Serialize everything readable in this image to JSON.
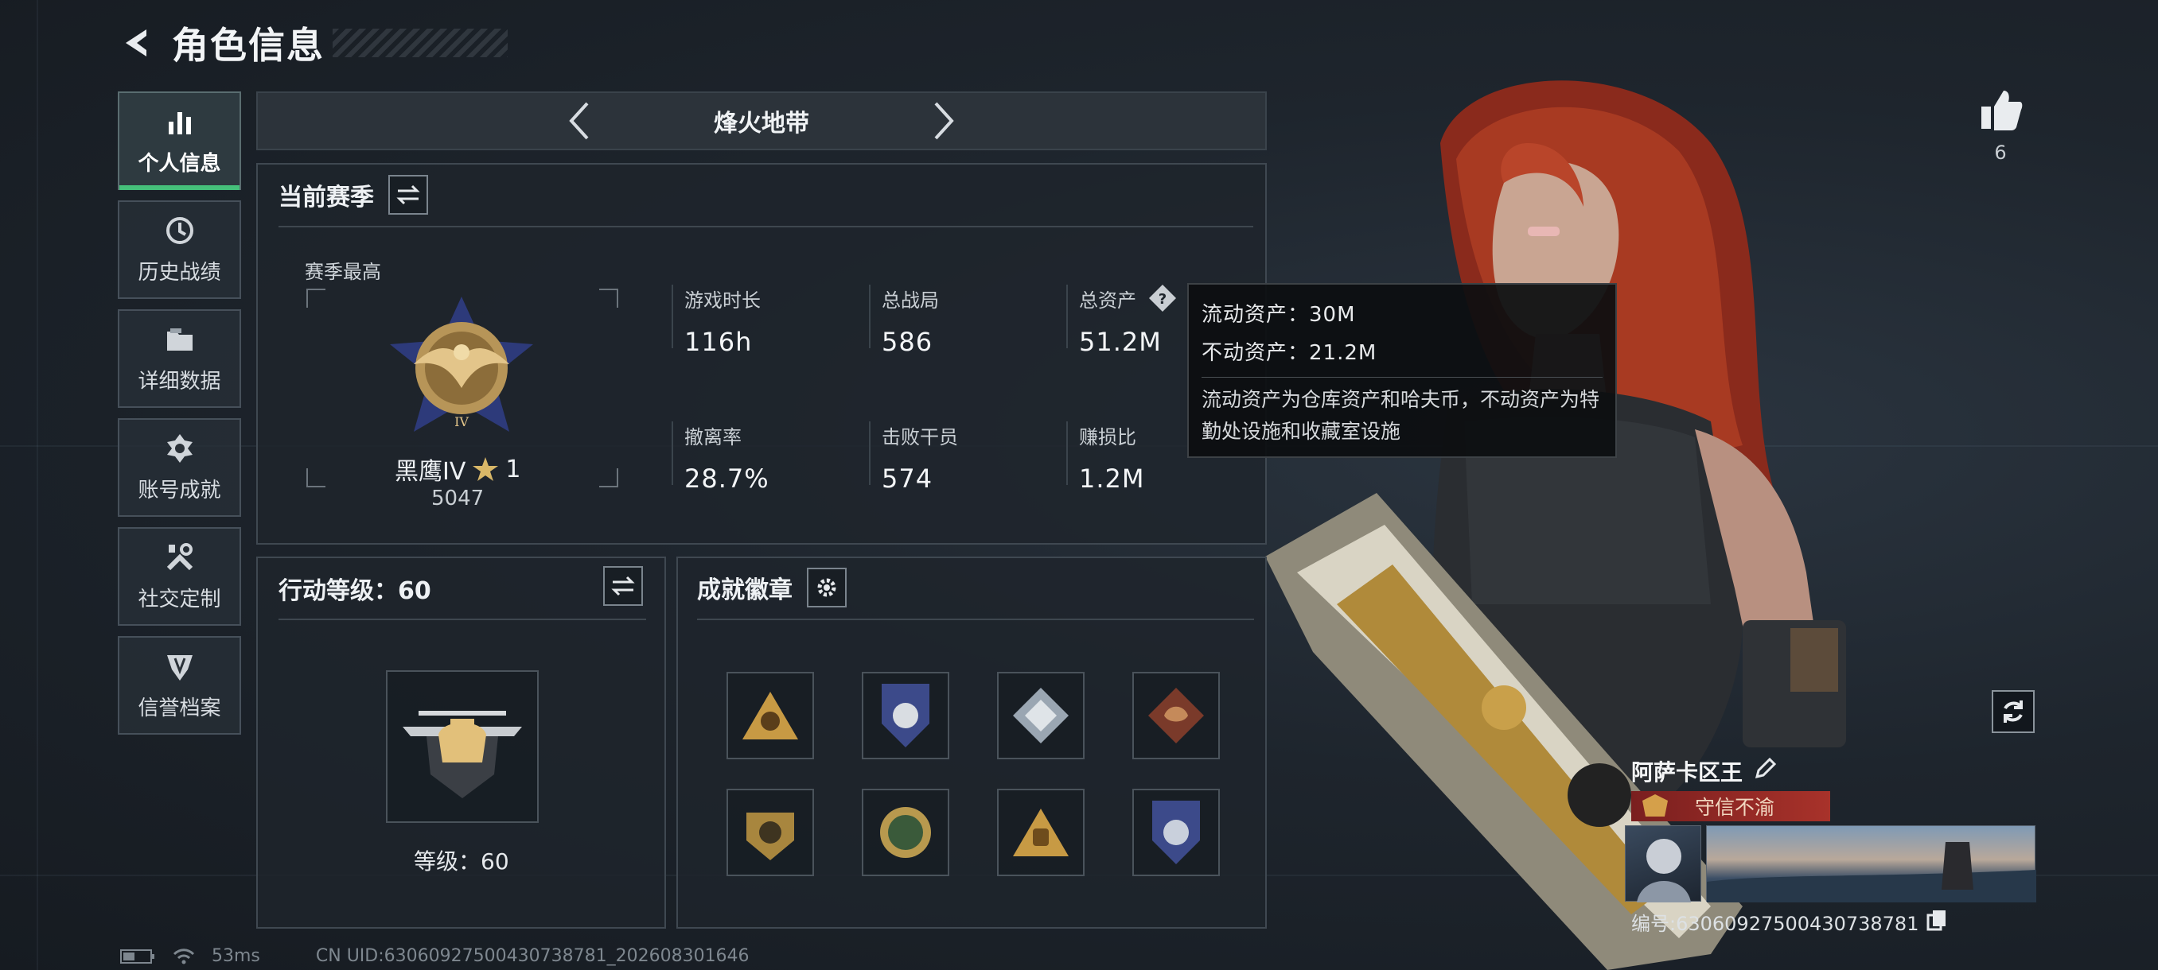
{
  "header": {
    "title": "角色信息"
  },
  "sidebar": {
    "items": [
      {
        "label": "个人信息",
        "icon": "bar-chart-icon",
        "active": true
      },
      {
        "label": "历史战绩",
        "icon": "clock-icon",
        "active": false
      },
      {
        "label": "详细数据",
        "icon": "folder-icon",
        "active": false
      },
      {
        "label": "账号成就",
        "icon": "achievement-icon",
        "active": false
      },
      {
        "label": "社交定制",
        "icon": "tools-icon",
        "active": false
      },
      {
        "label": "信誉档案",
        "icon": "shield-icon",
        "active": false
      }
    ]
  },
  "mode": {
    "title": "烽火地带"
  },
  "season": {
    "title": "当前赛季",
    "best_label": "赛季最高",
    "rank_name": "黑鹰IV",
    "rank_stars": "1",
    "rank_score": "5047",
    "stats": [
      {
        "label": "游戏时长",
        "value": "116h"
      },
      {
        "label": "总战局",
        "value": "586"
      },
      {
        "label": "总资产",
        "value": "51.2M"
      },
      {
        "label": "撤离率",
        "value": "28.7%"
      },
      {
        "label": "击败干员",
        "value": "574"
      },
      {
        "label": "赚损比",
        "value": "1.2M"
      }
    ]
  },
  "tooltip": {
    "liquid": "流动资产：30M",
    "fixed": "不动资产：21.2M",
    "desc": "流动资产为仓库资产和哈夫币，不动资产为特勤处设施和收藏室设施"
  },
  "action_level": {
    "title": "行动等级：60",
    "level_text": "等级：60"
  },
  "achievements": {
    "title": "成就徽章",
    "badges": [
      "badge-pyramid-icon",
      "badge-shield-icon",
      "badge-diamond-icon",
      "badge-dragon-icon",
      "badge-emblem-icon",
      "badge-wreath-icon",
      "badge-fist-icon",
      "badge-crest-icon"
    ]
  },
  "profile": {
    "likes": "6",
    "name": "阿萨卡区王",
    "title_tag": "守信不渝",
    "player_id": "编号:6306092750043073878​1"
  },
  "status_bar": {
    "ping": "53ms",
    "uid": "CN UID:6306092750043073878​1_202608301646"
  },
  "colors": {
    "accent_green": "#45c07a",
    "title_red": "#a8322a"
  }
}
